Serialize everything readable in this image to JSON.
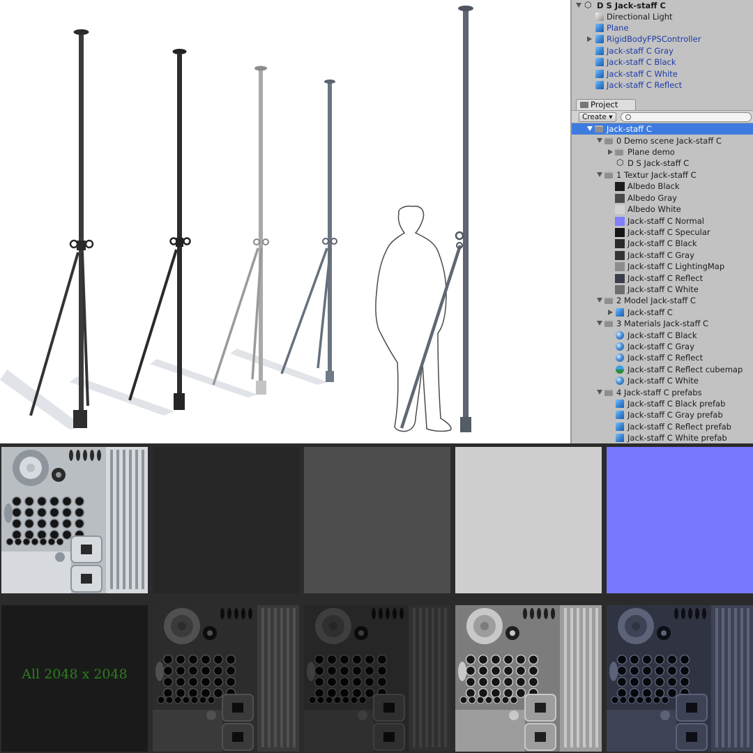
{
  "hierarchy": {
    "scene": "D S Jack-staff C",
    "items": [
      {
        "label": "Directional Light",
        "icon": "gray-cube-icon"
      },
      {
        "label": "Plane",
        "icon": "cube-icon"
      },
      {
        "label": "RigidBodyFPSController",
        "icon": "cube-icon",
        "expandable": true
      },
      {
        "label": "Jack-staff C Gray",
        "icon": "prefab-icon"
      },
      {
        "label": "Jack-staff C Black",
        "icon": "prefab-icon"
      },
      {
        "label": "Jack-staff C White",
        "icon": "prefab-icon"
      },
      {
        "label": "Jack-staff C Reflect",
        "icon": "prefab-icon"
      }
    ]
  },
  "project": {
    "tab_label": "Project",
    "create_label": "Create",
    "search_placeholder": "",
    "root": "Jack-staff C",
    "folders": [
      {
        "label": "0 Demo scene Jack-staff C",
        "children": [
          {
            "label": "Plane demo",
            "icon": "folder-icon"
          },
          {
            "label": "D S Jack-staff C",
            "icon": "unity-scene-icon"
          }
        ]
      },
      {
        "label": "1 Textur Jack-staff C",
        "children": [
          {
            "label": "Albedo Black",
            "swatch": "#1c1c1c"
          },
          {
            "label": "Albedo Gray",
            "swatch": "#4a4a4a"
          },
          {
            "label": "Albedo White",
            "swatch": "#d2d2d2"
          },
          {
            "label": "Jack-staff C  Normal",
            "swatch": "#7f7fff"
          },
          {
            "label": "Jack-staff C  Specular",
            "swatch": "#151515"
          },
          {
            "label": "Jack-staff C Black",
            "swatch": "#2a2a2a"
          },
          {
            "label": "Jack-staff C Gray",
            "swatch": "#333333"
          },
          {
            "label": "Jack-staff C LightingMap",
            "swatch": "#8c8c8c"
          },
          {
            "label": "Jack-staff C Reflect",
            "swatch": "#3a3e4c"
          },
          {
            "label": "Jack-staff C White",
            "swatch": "#6e6e6e"
          }
        ]
      },
      {
        "label": "2 Model Jack-staff C",
        "children": [
          {
            "label": "Jack-staff C",
            "icon": "model-icon"
          }
        ]
      },
      {
        "label": "3 Materials  Jack-staff C",
        "children": [
          {
            "label": "Jack-staff C Black",
            "icon": "material-icon"
          },
          {
            "label": "Jack-staff C Gray",
            "icon": "material-icon"
          },
          {
            "label": "Jack-staff C Reflect",
            "icon": "material-icon"
          },
          {
            "label": "Jack-staff C Reflect cubemap",
            "icon": "cubemap-icon"
          },
          {
            "label": "Jack-staff C White",
            "icon": "material-icon"
          }
        ]
      },
      {
        "label": "4 Jack-staff C  prefabs",
        "children": [
          {
            "label": "Jack-staff C Black prefab",
            "icon": "prefab-icon"
          },
          {
            "label": "Jack-staff C Gray prefab",
            "icon": "prefab-icon"
          },
          {
            "label": "Jack-staff C Reflect prefab",
            "icon": "prefab-icon"
          },
          {
            "label": "Jack-staff C White prefab",
            "icon": "prefab-icon"
          }
        ]
      }
    ]
  },
  "textures": {
    "size_note": "All 2048 x 2048",
    "colors": {
      "albedo_black": "#262626",
      "albedo_gray": "#4d4d4d",
      "albedo_white": "#cfcfcf",
      "normal": "#7878ff",
      "specular": "#1a1a1a",
      "accent": "#3d7be0"
    }
  }
}
